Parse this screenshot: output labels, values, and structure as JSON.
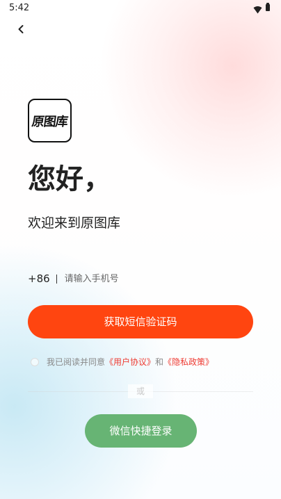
{
  "status_bar": {
    "time": "5:42",
    "wifi_icon": "wifi-icon",
    "battery_icon": "battery-icon"
  },
  "header": {
    "back_icon": "chevron-left-icon"
  },
  "app": {
    "logo_text": "原图库"
  },
  "main": {
    "greeting": "您好，",
    "subtitle": "欢迎来到原图库"
  },
  "login_form": {
    "country_code": "+86",
    "phone_placeholder": "请输入手机号",
    "phone_value": "",
    "sms_button_label": "获取短信验证码"
  },
  "agreement": {
    "checked": false,
    "prefix": "我已阅读并同意",
    "user_agreement": "《用户协议》",
    "conjunction": "和",
    "privacy_policy": "《隐私政策》"
  },
  "alternate_login": {
    "or_text": "或",
    "wechat_button_label": "微信快捷登录"
  },
  "colors": {
    "primary_button": "#ff4510",
    "wechat_button": "#67b474",
    "policy_link": "#ee3b32",
    "background_pink": "#ffe6e6",
    "background_blue": "#d4eef8"
  }
}
